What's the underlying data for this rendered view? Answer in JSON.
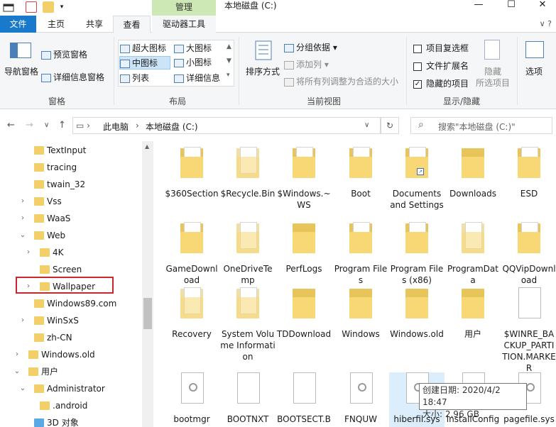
{
  "titlebar": {
    "manage_tab": "管理",
    "window_title": "本地磁盘 (C:)",
    "minimize": "—",
    "maximize": "☐",
    "close": "✕"
  },
  "tabs": {
    "file": "文件",
    "home": "主页",
    "share": "共享",
    "view": "查看",
    "drive_tools": "驱动器工具",
    "right_chevron": "∨ ?"
  },
  "ribbon": {
    "panes": {
      "nav_pane": "导航窗格",
      "preview_pane": "预览窗格",
      "details_pane": "详细信息窗格",
      "group": "窗格"
    },
    "layout": {
      "extra_large": "超大图标",
      "large": "大图标",
      "medium": "中图标",
      "small": "小图标",
      "list": "列表",
      "details": "详细信息",
      "group": "布局"
    },
    "current_view": {
      "sort_by": "排序方式",
      "group_by": "分组依据",
      "add_column": "添加列",
      "fit_columns": "将所有列调整为合适的大小",
      "group": "当前视图"
    },
    "show_hide": {
      "item_checkboxes": "项目复选框",
      "file_extensions": "文件扩展名",
      "hidden_items": "隐藏的项目",
      "hide": "隐藏",
      "hide_selected": "所选项目",
      "group": "显示/隐藏"
    },
    "options": "选项"
  },
  "navbar": {
    "back": "←",
    "forward": "→",
    "dropdown": "∨",
    "up": "↑",
    "crumbs": [
      "此电脑",
      "本地磁盘 (C:)"
    ],
    "refresh": "↻",
    "search_placeholder": "搜索\"本地磁盘 (C:)\""
  },
  "tree": [
    {
      "label": "TextInput"
    },
    {
      "label": "tracing"
    },
    {
      "label": "twain_32"
    },
    {
      "label": "Vss",
      "exp": "›"
    },
    {
      "label": "WaaS",
      "exp": "›"
    },
    {
      "label": "Web",
      "exp": "⌄"
    },
    {
      "label": "4K",
      "exp": "›"
    },
    {
      "label": "Screen"
    },
    {
      "label": "Wallpaper",
      "exp": "›"
    },
    {
      "label": "Windows89.com"
    },
    {
      "label": "WinSxS",
      "exp": "›"
    },
    {
      "label": "zh-CN"
    },
    {
      "label": "Windows.old",
      "exp": "›"
    },
    {
      "label": "用户",
      "exp": "⌄"
    },
    {
      "label": "Administrator",
      "exp": "⌄"
    },
    {
      "label": ".android"
    },
    {
      "label": "3D 对象"
    }
  ],
  "items": [
    {
      "label": "$360Section",
      "kind": "folder-page"
    },
    {
      "label": "$Recycle.Bin",
      "kind": "folder-faded"
    },
    {
      "label": "$Windows.~WS",
      "kind": "folder-page"
    },
    {
      "label": "Boot",
      "kind": "folder-page"
    },
    {
      "label": "Documents and Settings",
      "kind": "folder-shortcut"
    },
    {
      "label": "Downloads",
      "kind": "folder"
    },
    {
      "label": "ESD",
      "kind": "folder-page"
    },
    {
      "label": "GameDownload",
      "kind": "folder-page"
    },
    {
      "label": "OneDriveTemp",
      "kind": "folder-faded"
    },
    {
      "label": "PerfLogs",
      "kind": "folder"
    },
    {
      "label": "Program Files",
      "kind": "folder-page"
    },
    {
      "label": "Program Files (x86)",
      "kind": "folder-page"
    },
    {
      "label": "ProgramData",
      "kind": "folder-faded"
    },
    {
      "label": "QQVipDownload",
      "kind": "folder-page"
    },
    {
      "label": "Recovery",
      "kind": "folder-faded"
    },
    {
      "label": "System Volume Information",
      "kind": "folder-faded"
    },
    {
      "label": "TDDownload",
      "kind": "folder"
    },
    {
      "label": "Windows",
      "kind": "folder"
    },
    {
      "label": "Windows.old",
      "kind": "folder"
    },
    {
      "label": "用户",
      "kind": "folder"
    },
    {
      "label": "$WINRE_BACKUP_PARTITION.MARKER",
      "kind": "file"
    },
    {
      "label": "bootmgr",
      "kind": "sysfile"
    },
    {
      "label": "BOOTNXT",
      "kind": "file"
    },
    {
      "label": "BOOTSECT.BAK",
      "kind": "file"
    },
    {
      "label": "FNQUW",
      "kind": "sysfile"
    },
    {
      "label": "hiberfil.sys",
      "kind": "sysfile"
    },
    {
      "label": "installConfig",
      "kind": "sysfile"
    },
    {
      "label": "pagefile.sys",
      "kind": "sysfile"
    }
  ],
  "tooltip": {
    "created": "创建日期: 2020/4/2 18:47",
    "size": "大小: 2.96 GB"
  },
  "colors": {
    "accent": "#1979ca",
    "manage_tab": "#cde8b4",
    "highlight_box": "#c8282d",
    "folder": "#f8d775"
  }
}
